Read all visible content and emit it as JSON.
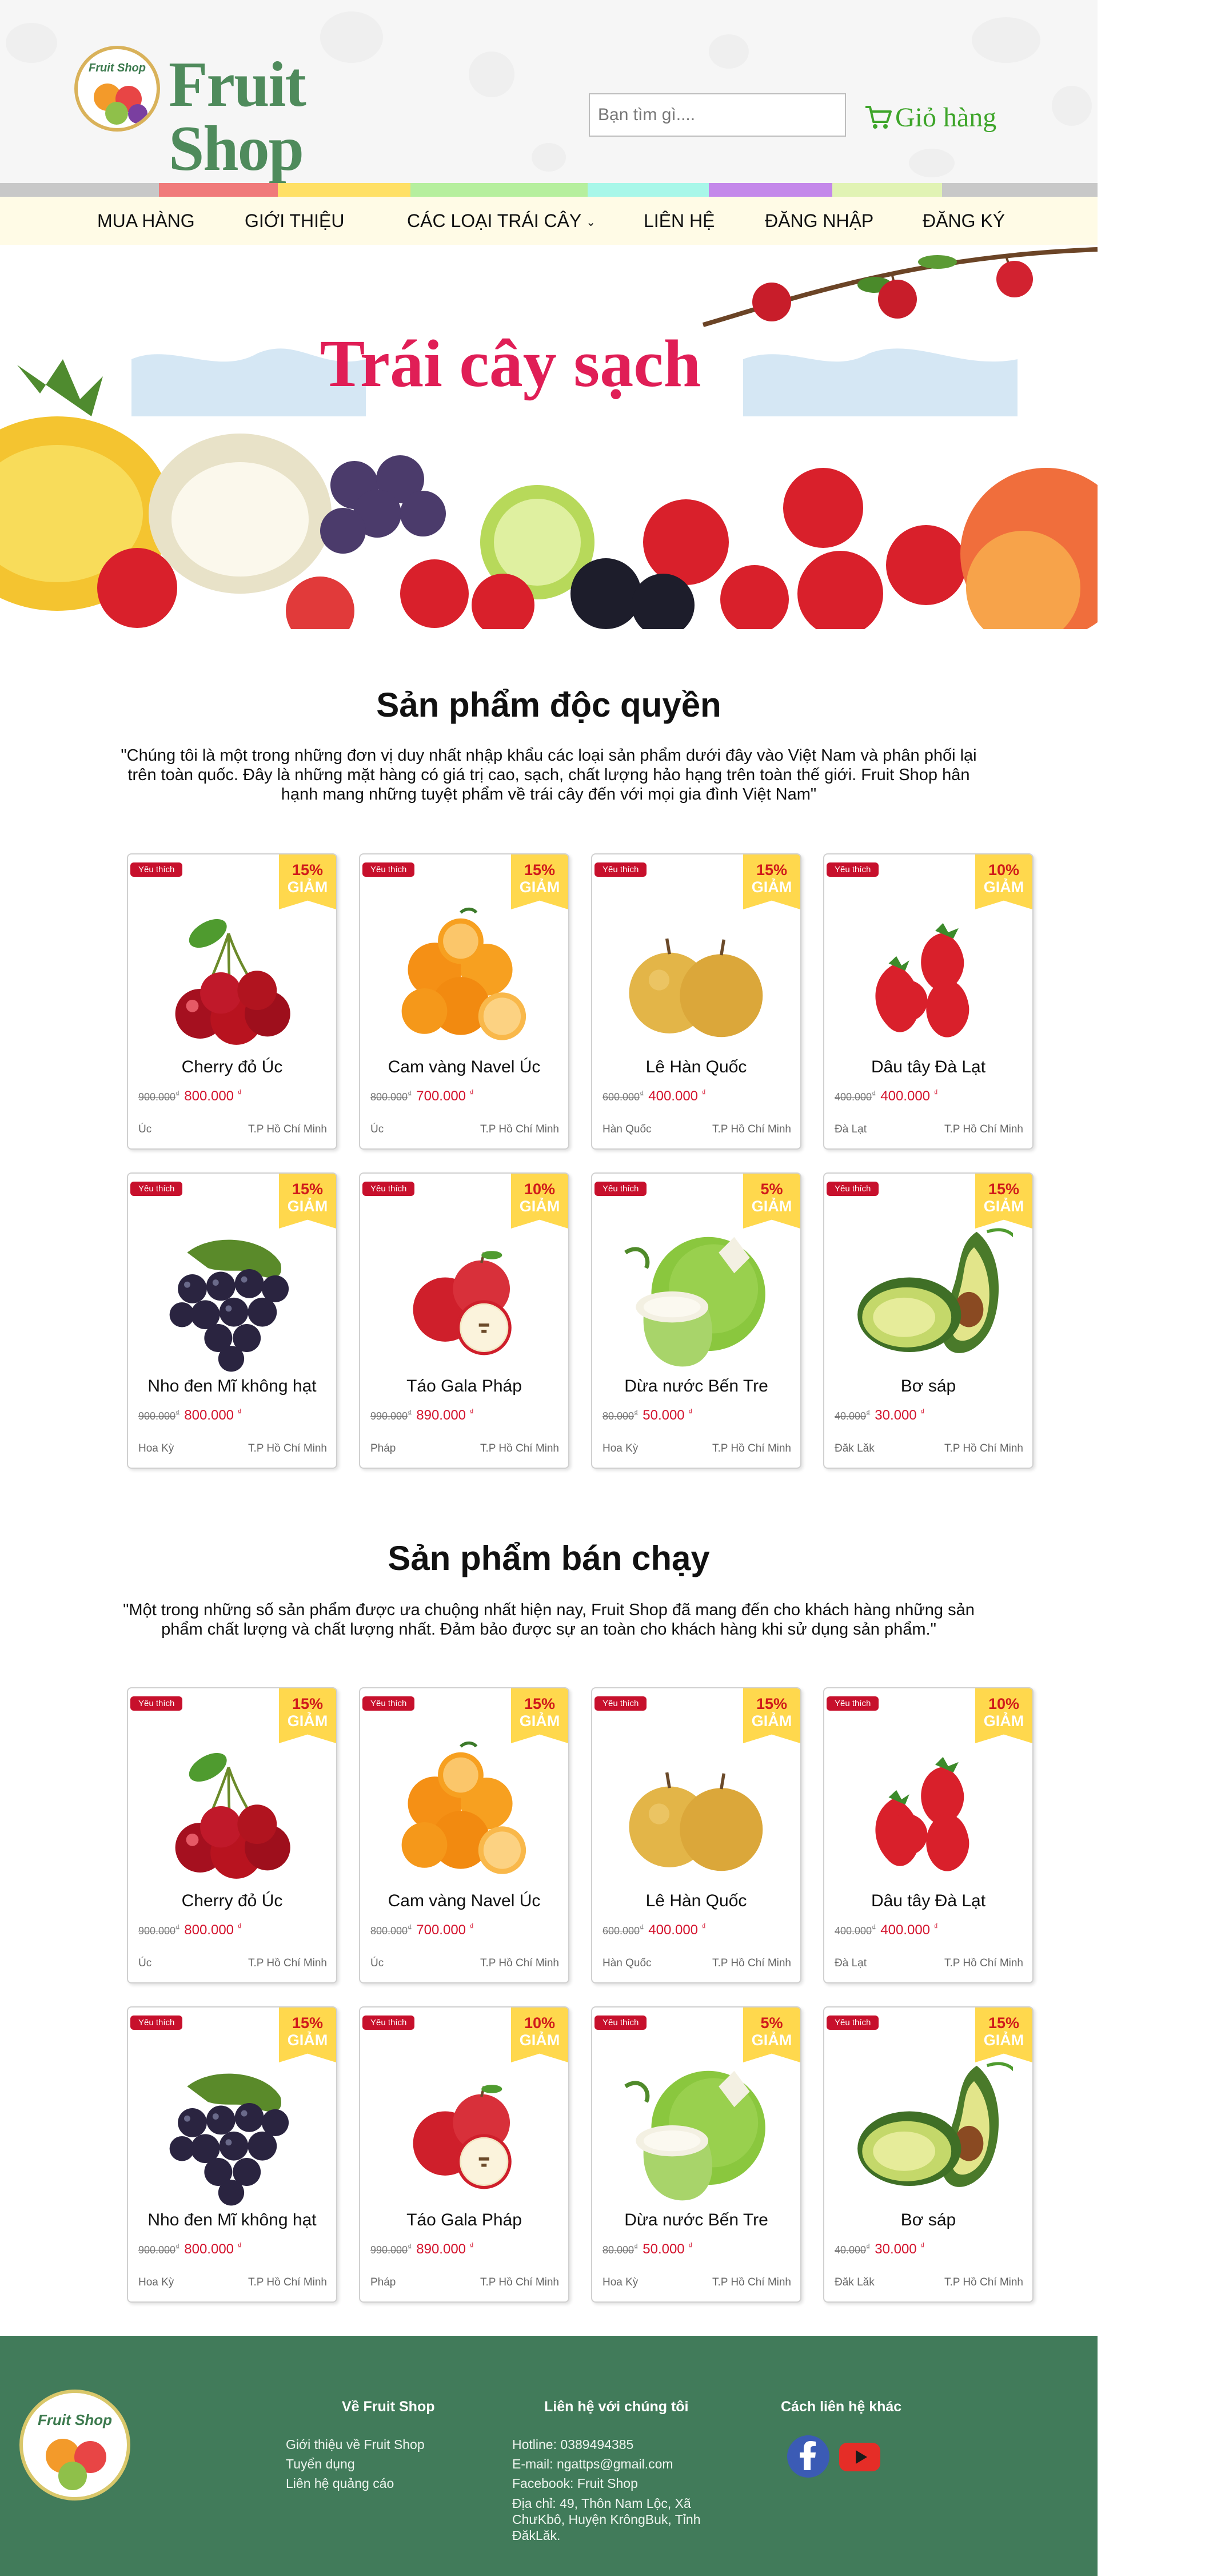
{
  "brand": {
    "badge_text": "Fruit Shop",
    "name": "Fruit Shop"
  },
  "search": {
    "placeholder": "Bạn tìm gì...."
  },
  "cart": {
    "label": "Giỏ  hàng",
    "icon": "cart-icon"
  },
  "colors": {
    "stripe": [
      "#c8c8c8",
      "#f07a7a",
      "#ffe066",
      "#b6ef9e",
      "#a8f7e9",
      "#c488ea",
      "#e1f3b4",
      "#c8c8c8"
    ],
    "nav_bg": "#fffbe6",
    "footer_bg": "#417b5a",
    "price_red": "#d4142e",
    "badge_yellow": "#ffd84d",
    "banner_title": "#e01e56"
  },
  "nav": {
    "items": [
      {
        "label": "MUA HÀNG"
      },
      {
        "label": "GIỚI THIỆU"
      },
      {
        "label": "CÁC LOẠI TRÁI CÂY",
        "dropdown": true
      },
      {
        "label": "LIÊN HỆ"
      },
      {
        "label": "ĐĂNG NHẬP"
      },
      {
        "label": "ĐĂNG KÝ"
      }
    ]
  },
  "banner": {
    "title": "Trái cây sạch"
  },
  "exclusive": {
    "title": "Sản phẩm độc quyền",
    "desc": "\"Chúng tôi là một trong những đơn vị duy nhất nhập khẩu các loại sản phẩm dưới đây vào Việt Nam và phân phối lại trên toàn quốc. Đây là những mặt hàng có giá trị cao, sạch, chất lượng hảo hạng trên toàn thế giới. Fruit Shop hân hạnh mang những tuyệt phẩm về trái cây đến với mọi gia đình Việt Nam\""
  },
  "bestseller": {
    "title": "Sản phẩm bán chạy",
    "desc": "\"Một trong những số sản phẩm được ưa chuộng nhất hiện nay, Fruit Shop đã mang đến cho khách hàng những sản phẩm chất lượng và chất lượng nhất. Đảm bảo được sự an toàn cho khách hàng khi sử dụng sản phẩm.\""
  },
  "card_labels": {
    "fav": "Yêu thích",
    "giam": "GIẢM",
    "currency": "₫"
  },
  "products": [
    {
      "name": "Cherry đỏ Úc",
      "discount": "15%",
      "old_price": "900.000",
      "new_price": "800.000",
      "origin": "Úc",
      "ship_from": "T.P Hồ Chí Minh",
      "icon": "cherry-icon"
    },
    {
      "name": "Cam vàng Navel Úc",
      "discount": "15%",
      "old_price": "800.000",
      "new_price": "700.000",
      "origin": "Úc",
      "ship_from": "T.P Hồ Chí Minh",
      "icon": "orange-icon"
    },
    {
      "name": "Lê Hàn Quốc",
      "discount": "15%",
      "old_price": "600.000",
      "new_price": "400.000",
      "origin": "Hàn Quốc",
      "ship_from": "T.P Hồ Chí Minh",
      "icon": "pear-icon"
    },
    {
      "name": "Dâu tây Đà Lạt",
      "discount": "10%",
      "old_price": "400.000",
      "new_price": "400.000",
      "origin": "Đà Lạt",
      "ship_from": "T.P Hồ Chí Minh",
      "icon": "strawberry-icon"
    },
    {
      "name": "Nho đen Mĩ không hạt",
      "discount": "15%",
      "old_price": "900.000",
      "new_price": "800.000",
      "origin": "Hoa Kỳ",
      "ship_from": "T.P Hồ Chí Minh",
      "icon": "grape-icon"
    },
    {
      "name": "Táo Gala Pháp",
      "discount": "10%",
      "old_price": "990.000",
      "new_price": "890.000",
      "origin": "Pháp",
      "ship_from": "T.P Hồ Chí Minh",
      "icon": "apple-icon"
    },
    {
      "name": "Dừa nước Bến Tre",
      "discount": "5%",
      "old_price": "80.000",
      "new_price": "50.000",
      "origin": "Hoa Kỳ",
      "ship_from": "T.P Hồ Chí Minh",
      "icon": "coconut-icon"
    },
    {
      "name": "Bơ sáp",
      "discount": "15%",
      "old_price": "40.000",
      "new_price": "30.000",
      "origin": "Đăk Lăk",
      "ship_from": "T.P Hồ Chí Minh",
      "icon": "avocado-icon"
    }
  ],
  "footer": {
    "logo_text": "Fruit Shop",
    "about": {
      "title": "Về Fruit Shop",
      "links": [
        "Giới thiệu về Fruit Shop",
        "Tuyển dụng",
        "Liên hệ quảng cáo"
      ]
    },
    "contact": {
      "title": "Liên hệ với chúng tôi",
      "hotline": "Hotline: 0389494385",
      "email": "E-mail: ngattps@gmail.com",
      "facebook": "Facebook: Fruit Shop",
      "address": "Địa chỉ: 49, Thôn Nam Lộc, Xã ChưKbô, Huyện KrôngBuk, Tỉnh ĐăkLăk."
    },
    "other": {
      "title": "Cách liên hệ khác",
      "icons": [
        "facebook-icon",
        "youtube-icon"
      ]
    }
  }
}
